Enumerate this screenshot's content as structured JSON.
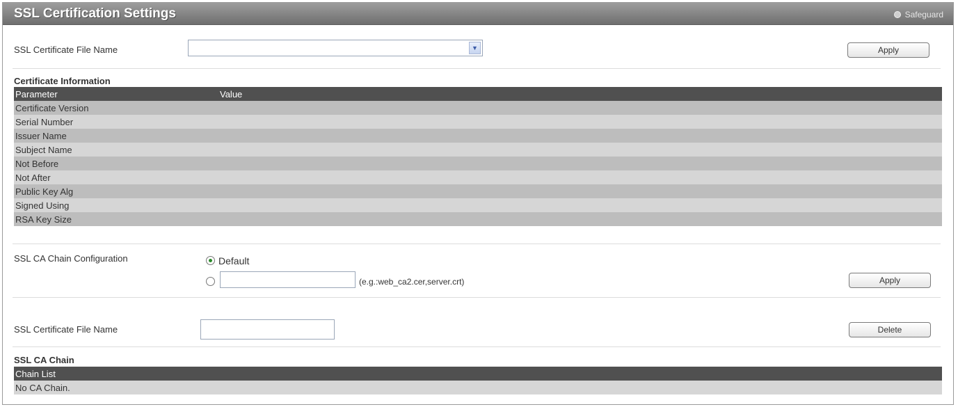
{
  "header": {
    "title": "SSL Certification Settings",
    "safeguard": "Safeguard"
  },
  "cert_file": {
    "label": "SSL Certificate File Name",
    "selected": "",
    "apply_label": "Apply"
  },
  "cert_info": {
    "title": "Certificate Information",
    "columns": [
      "Parameter",
      "Value"
    ],
    "rows": [
      "Certificate Version",
      "Serial Number",
      "Issuer Name",
      "Subject Name",
      "Not Before",
      "Not After",
      "Public Key Alg",
      "Signed Using",
      "RSA Key Size"
    ]
  },
  "ca_chain_config": {
    "label": "SSL CA Chain Configuration",
    "default_label": "Default",
    "custom_value": "",
    "hint": "(e.g.:web_ca2.cer,server.crt)",
    "apply_label": "Apply"
  },
  "delete_file": {
    "label": "SSL Certificate File Name",
    "value": "",
    "delete_label": "Delete"
  },
  "ca_chain": {
    "title": "SSL CA Chain",
    "column": "Chain List",
    "empty": "No CA Chain."
  },
  "colors": {
    "header_dark": "#505050",
    "row_odd": "#bdbdbd",
    "row_even": "#d6d6d6"
  }
}
